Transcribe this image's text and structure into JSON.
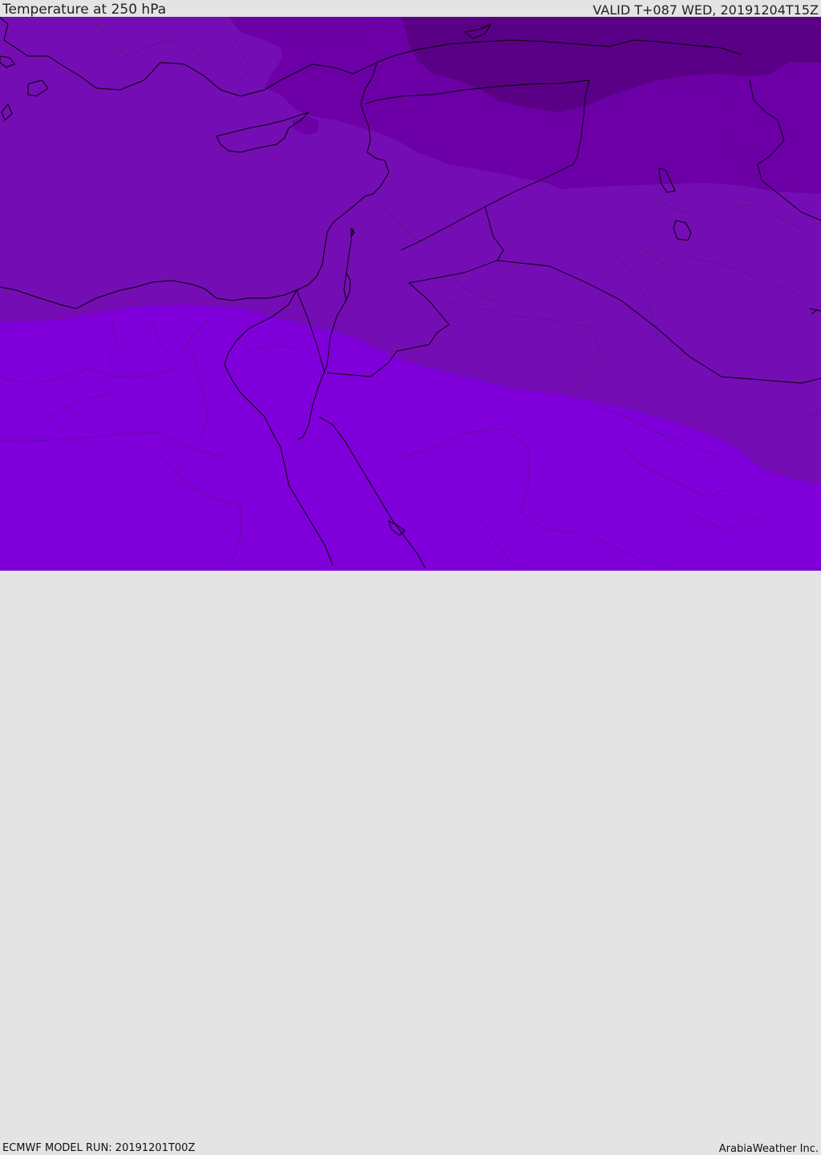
{
  "header": {
    "title": "Temperature at 250 hPa",
    "valid": "VALID T+087 WED, 20191204T15Z"
  },
  "footer": {
    "model_run": "ECMWF MODEL RUN: 20191201T00Z",
    "credit": "ArabiaWeather Inc."
  },
  "map": {
    "colors": {
      "band_warmest": "#7f00da",
      "band_2": "#750db5",
      "band_3": "#6c00a6",
      "band_coldest": "#5a0086",
      "coastline": "#000000",
      "border": "#000000"
    }
  }
}
